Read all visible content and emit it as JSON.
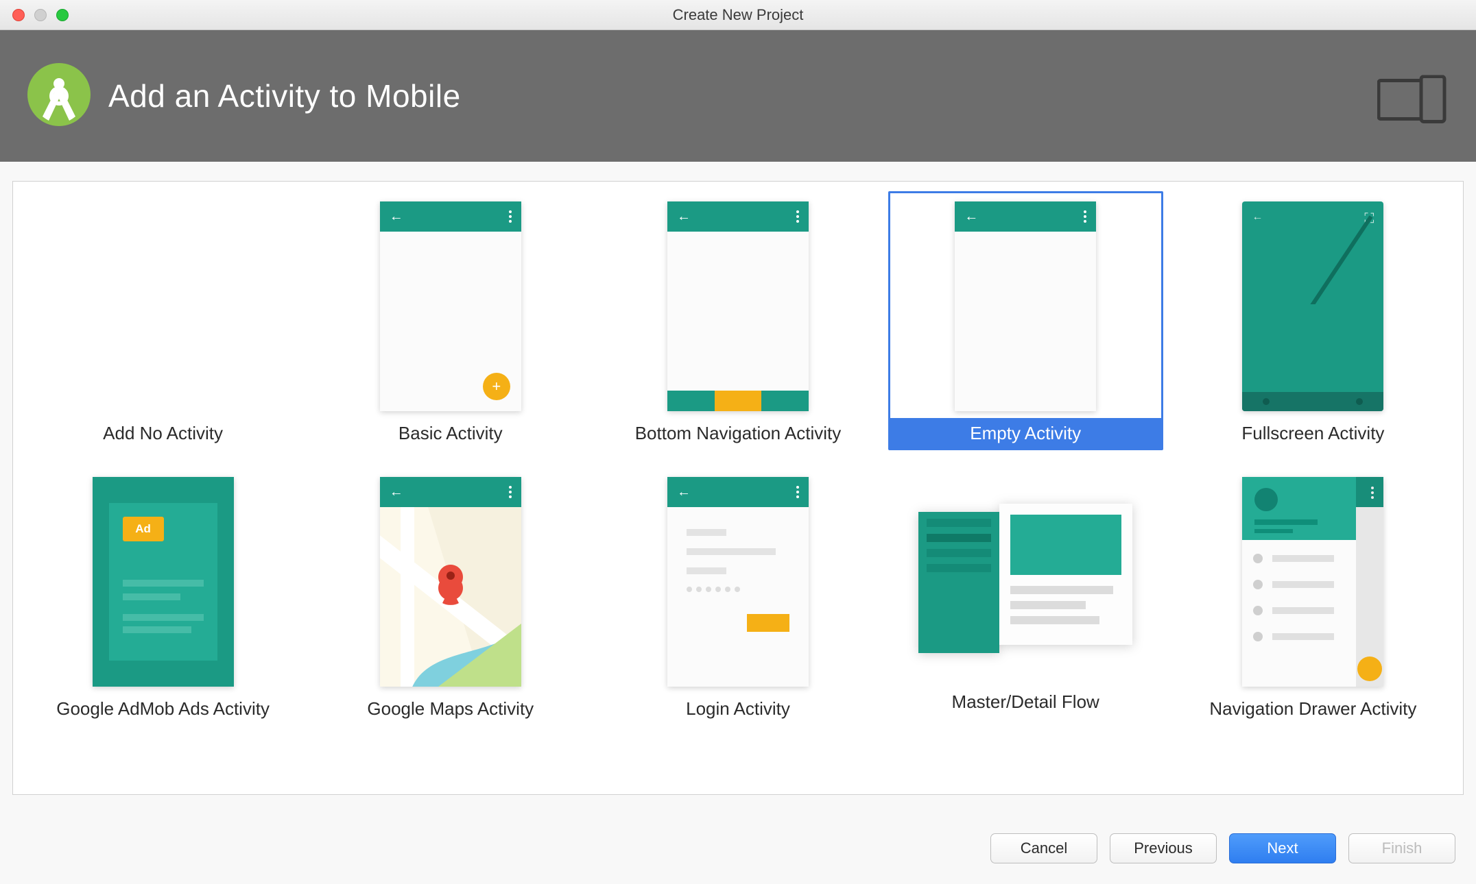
{
  "window": {
    "title": "Create New Project"
  },
  "header": {
    "title": "Add an Activity to Mobile"
  },
  "templates": [
    {
      "label": "Add No Activity"
    },
    {
      "label": "Basic Activity"
    },
    {
      "label": "Bottom Navigation Activity"
    },
    {
      "label": "Empty Activity",
      "selected": true
    },
    {
      "label": "Fullscreen Activity"
    },
    {
      "label": "Google AdMob Ads Activity"
    },
    {
      "label": "Google Maps Activity"
    },
    {
      "label": "Login Activity"
    },
    {
      "label": "Master/Detail Flow"
    },
    {
      "label": "Navigation Drawer Activity"
    }
  ],
  "admob": {
    "chip": "Ad"
  },
  "buttons": {
    "cancel": "Cancel",
    "previous": "Previous",
    "next": "Next",
    "finish": "Finish"
  }
}
